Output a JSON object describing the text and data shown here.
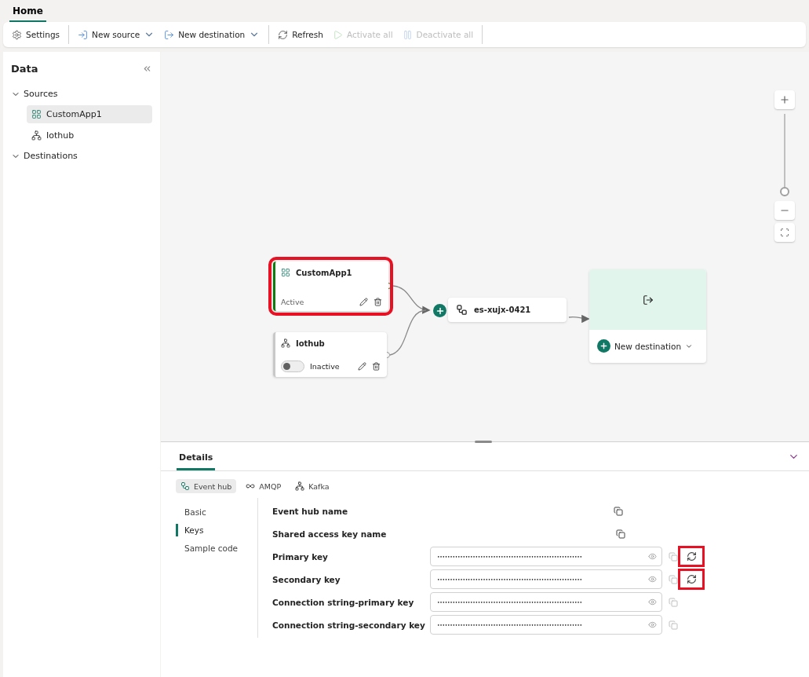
{
  "tabs": [
    {
      "label": "Home",
      "selected": true
    }
  ],
  "toolbar": [
    {
      "label": "Settings",
      "disabled": false,
      "dropdown": false
    },
    {
      "label": "New source",
      "disabled": false,
      "dropdown": true
    },
    {
      "label": "New destination",
      "disabled": false,
      "dropdown": true
    },
    {
      "label": "Refresh",
      "disabled": false,
      "dropdown": false
    },
    {
      "label": "Activate all",
      "disabled": true,
      "dropdown": false
    },
    {
      "label": "Deactivate all",
      "disabled": true,
      "dropdown": false
    }
  ],
  "sidebar": {
    "title": "Data",
    "groups": [
      {
        "label": "Sources",
        "expanded": true,
        "items": [
          {
            "label": "CustomApp1",
            "selected": true
          },
          {
            "label": "Iothub",
            "selected": false
          }
        ]
      },
      {
        "label": "Destinations",
        "expanded": true
      }
    ]
  },
  "canvas": {
    "sources": [
      {
        "name": "CustomApp1",
        "status": "Active",
        "kind": "static",
        "active": true,
        "highlighted": true
      },
      {
        "name": "Iothub",
        "status": "Inactive",
        "kind": "toggle",
        "active": false,
        "highlighted": false
      }
    ],
    "stream": {
      "name": "es-xujx-0421"
    },
    "destination": {
      "label": "New destination"
    },
    "zoom": {
      "level": 0
    }
  },
  "details": {
    "tab": "Details",
    "protocols": [
      {
        "label": "Event hub",
        "selected": true
      },
      {
        "label": "AMQP",
        "selected": false
      },
      {
        "label": "Kafka",
        "selected": false
      }
    ],
    "nav": [
      {
        "label": "Basic",
        "selected": false
      },
      {
        "label": "Keys",
        "selected": true
      },
      {
        "label": "Sample code",
        "selected": false
      }
    ],
    "fields": [
      {
        "label": "Event hub name",
        "kind": "plain"
      },
      {
        "label": "Shared access key name",
        "kind": "plain"
      },
      {
        "label": "Primary key",
        "kind": "secret",
        "value": "•••••••••••••••••••••••••••••••••••••••••••••••••••••••••",
        "regenerate": true,
        "highlighted": true
      },
      {
        "label": "Secondary key",
        "kind": "secret",
        "value": "•••••••••••••••••••••••••••••••••••••••••••••••••••••••••",
        "regenerate": true,
        "highlighted": true
      },
      {
        "label": "Connection string-primary key",
        "kind": "secret",
        "value": "•••••••••••••••••••••••••••••••••••••••••••••••••••••••••",
        "regenerate": false
      },
      {
        "label": "Connection string-secondary key",
        "kind": "secret",
        "value": "•••••••••••••••••••••••••••••••••••••••••••••••••••••••••",
        "regenerate": false
      }
    ]
  }
}
